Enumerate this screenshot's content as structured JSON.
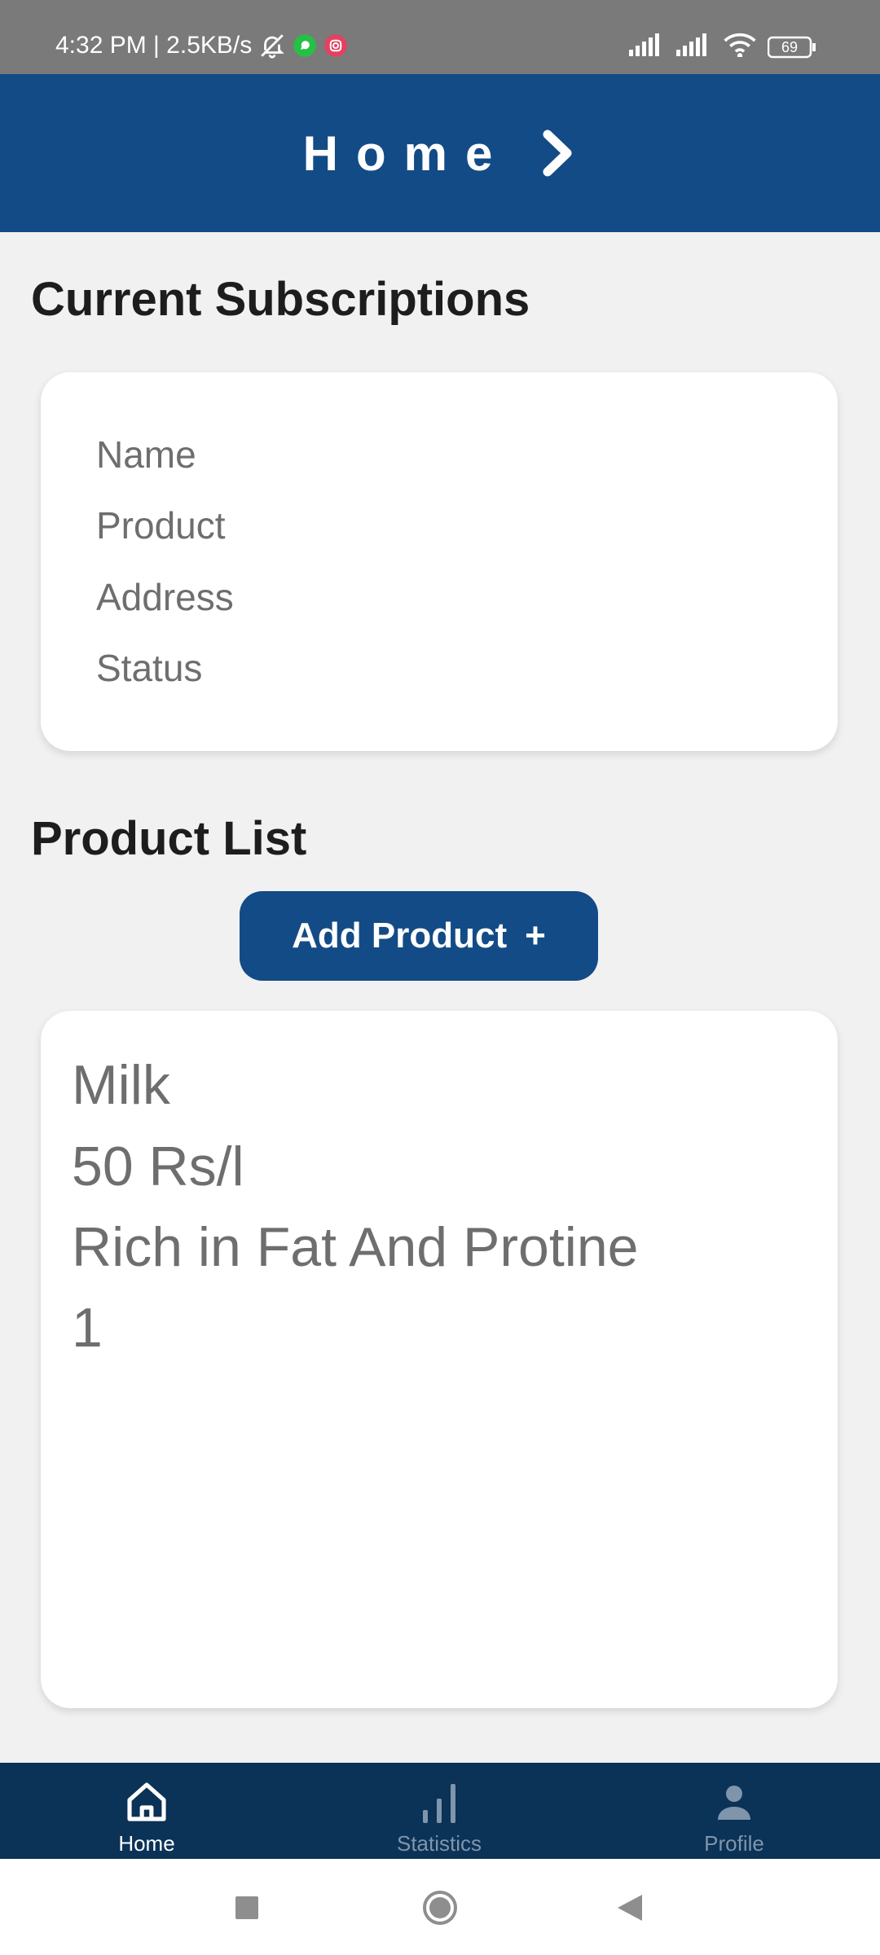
{
  "status_bar": {
    "time_speed": "4:32 PM | 2.5KB/s",
    "battery": "69",
    "icons": [
      "bell-off-icon",
      "whatsapp-icon",
      "instagram-icon",
      "signal-icon",
      "signal-icon",
      "wifi-icon",
      "battery-icon"
    ]
  },
  "app_bar": {
    "title": "Home",
    "icon": "chevron-right-icon"
  },
  "subscriptions": {
    "heading": "Current Subscriptions",
    "fields": [
      "Name",
      "Product",
      "Address",
      "Status"
    ]
  },
  "products": {
    "heading": "Product List",
    "add_button_label": "Add Product",
    "add_button_symbol": "+",
    "items": [
      {
        "name": "Milk",
        "price": "50 Rs/l",
        "description": "Rich in Fat And Protine",
        "quantity": "1"
      }
    ]
  },
  "bottom_nav": {
    "items": [
      {
        "label": "Home",
        "icon": "home-icon",
        "active": true
      },
      {
        "label": "Statistics",
        "icon": "bar-chart-icon",
        "active": false
      },
      {
        "label": "Profile",
        "icon": "person-icon",
        "active": false
      }
    ]
  },
  "system_nav": {
    "icons": [
      "recents-icon",
      "home-circle-icon",
      "back-icon"
    ]
  },
  "colors": {
    "primary": "#134b86",
    "bottom_nav_bg": "#0b3257",
    "page_bg": "#f1f1f1",
    "card_bg": "#ffffff",
    "muted_text": "#6e6e6e"
  }
}
